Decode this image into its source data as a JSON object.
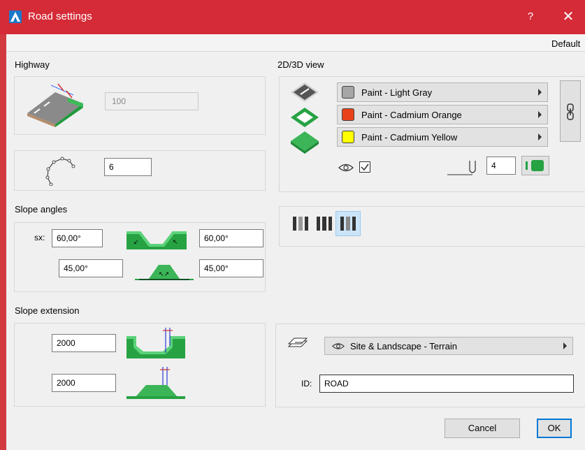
{
  "window": {
    "title": "Road settings",
    "help": "?",
    "close": "✕"
  },
  "header": {
    "default_label": "Default"
  },
  "highway": {
    "label": "Highway",
    "width_value": "100",
    "segments_value": "6"
  },
  "slope_angles": {
    "label": "Slope angles",
    "sx_label": "sx:",
    "top_left": "60,00°",
    "top_right": "60,00°",
    "bottom_left": "45,00°",
    "bottom_right": "45,00°"
  },
  "slope_extension": {
    "label": "Slope extension",
    "top_value": "2000",
    "bottom_value": "2000"
  },
  "view": {
    "label": "2D/3D view",
    "materials": [
      {
        "label": "Paint - Light Gray",
        "color": "#a6a6a6"
      },
      {
        "label": "Paint - Cadmium Orange",
        "color": "#e8421a"
      },
      {
        "label": "Paint - Cadmium Yellow",
        "color": "#ffff00"
      }
    ],
    "pen_value": "4"
  },
  "layer": {
    "layer_label": "Site & Landscape - Terrain",
    "id_label": "ID:",
    "id_value": "ROAD"
  },
  "buttons": {
    "cancel": "Cancel",
    "ok": "OK"
  },
  "colors": {
    "titlebar": "#d52b37",
    "accent": "#0078d7",
    "road_green": "#27a243"
  }
}
